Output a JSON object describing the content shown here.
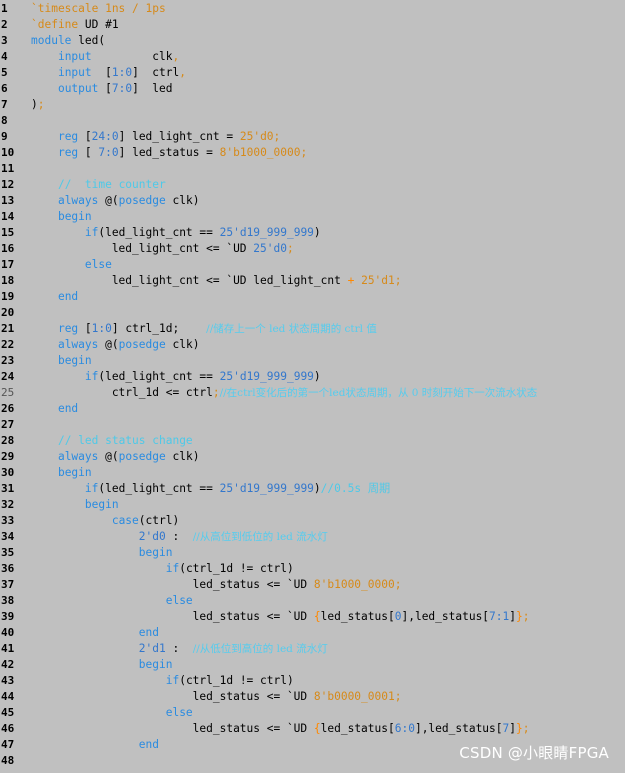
{
  "watermark": "CSDN @小眼睛FPGA",
  "lines": [
    {
      "n": "1",
      "parts": [
        [
          "dir",
          "`timescale 1ns / 1ps"
        ]
      ]
    },
    {
      "n": "2",
      "parts": [
        [
          "dir",
          "`define"
        ],
        [
          "",
          " UD #1"
        ]
      ]
    },
    {
      "n": "3",
      "parts": [
        [
          "kw",
          "module"
        ],
        [
          "",
          " led("
        ]
      ]
    },
    {
      "n": "4",
      "parts": [
        [
          "",
          "    "
        ],
        [
          "kw",
          "input"
        ],
        [
          "",
          "         clk"
        ],
        [
          "dir",
          ","
        ]
      ]
    },
    {
      "n": "5",
      "parts": [
        [
          "",
          "    "
        ],
        [
          "kw",
          "input"
        ],
        [
          "",
          "  ["
        ],
        [
          "num-b",
          "1:0"
        ],
        [
          "",
          "]  ctrl"
        ],
        [
          "dir",
          ","
        ]
      ]
    },
    {
      "n": "6",
      "parts": [
        [
          "",
          "    "
        ],
        [
          "kw",
          "output"
        ],
        [
          "",
          " ["
        ],
        [
          "num-b",
          "7:0"
        ],
        [
          "",
          "]  led"
        ]
      ]
    },
    {
      "n": "7",
      "parts": [
        [
          "",
          ")"
        ],
        [
          "dir",
          ";"
        ]
      ]
    },
    {
      "n": "8",
      "parts": []
    },
    {
      "n": "9",
      "parts": [
        [
          "",
          "    "
        ],
        [
          "kw",
          "reg"
        ],
        [
          "",
          " ["
        ],
        [
          "num-b",
          "24:0"
        ],
        [
          "",
          "] led_light_cnt = "
        ],
        [
          "num",
          "25'd0;"
        ]
      ]
    },
    {
      "n": "10",
      "parts": [
        [
          "",
          "    "
        ],
        [
          "kw",
          "reg"
        ],
        [
          "",
          " [ "
        ],
        [
          "num-b",
          "7:0"
        ],
        [
          "",
          "] led_status = "
        ],
        [
          "num",
          "8'b1000_0000;"
        ]
      ]
    },
    {
      "n": "11",
      "parts": []
    },
    {
      "n": "12",
      "parts": [
        [
          "",
          "    "
        ],
        [
          "cm",
          "//  time counter"
        ]
      ]
    },
    {
      "n": "13",
      "parts": [
        [
          "",
          "    "
        ],
        [
          "kw",
          "always"
        ],
        [
          "",
          " @("
        ],
        [
          "kw",
          "posedge"
        ],
        [
          "",
          " clk)"
        ]
      ]
    },
    {
      "n": "14",
      "parts": [
        [
          "",
          "    "
        ],
        [
          "kw",
          "begin"
        ]
      ]
    },
    {
      "n": "15",
      "parts": [
        [
          "",
          "        "
        ],
        [
          "kw",
          "if"
        ],
        [
          "",
          "(led_light_cnt == "
        ],
        [
          "num-b",
          "25'd19_999_999"
        ],
        [
          "",
          ")"
        ]
      ]
    },
    {
      "n": "16",
      "parts": [
        [
          "",
          "            led_light_cnt <= `UD "
        ],
        [
          "num-b",
          "25'd0"
        ],
        [
          "dir",
          ";"
        ]
      ]
    },
    {
      "n": "17",
      "parts": [
        [
          "",
          "        "
        ],
        [
          "kw",
          "else"
        ]
      ]
    },
    {
      "n": "18",
      "parts": [
        [
          "",
          "            led_light_cnt <= `UD led_light_cnt "
        ],
        [
          "op",
          "+"
        ],
        [
          "",
          " "
        ],
        [
          "num",
          "25'd1;"
        ]
      ]
    },
    {
      "n": "19",
      "parts": [
        [
          "",
          "    "
        ],
        [
          "kw",
          "end"
        ]
      ]
    },
    {
      "n": "20",
      "parts": []
    },
    {
      "n": "21",
      "parts": [
        [
          "",
          "    "
        ],
        [
          "kw",
          "reg"
        ],
        [
          "",
          " ["
        ],
        [
          "num-b",
          "1:0"
        ],
        [
          "",
          "] ctrl_1d;    "
        ],
        [
          "cm-cn",
          "//储存上一个 led 状态周期的 ctrl 值"
        ]
      ]
    },
    {
      "n": "22",
      "parts": [
        [
          "",
          "    "
        ],
        [
          "kw",
          "always"
        ],
        [
          "",
          " @("
        ],
        [
          "kw",
          "posedge"
        ],
        [
          "",
          " clk)"
        ]
      ]
    },
    {
      "n": "23",
      "parts": [
        [
          "",
          "    "
        ],
        [
          "kw",
          "begin"
        ]
      ]
    },
    {
      "n": "24",
      "parts": [
        [
          "",
          "        "
        ],
        [
          "kw",
          "if"
        ],
        [
          "",
          "(led_light_cnt == "
        ],
        [
          "num-b",
          "25'd19_999_999"
        ],
        [
          "",
          ")"
        ]
      ]
    },
    {
      "n": "25",
      "dim": true,
      "parts": [
        [
          "",
          "            ctrl_1d <= ctrl"
        ],
        [
          "dir",
          ";"
        ],
        [
          "cm-cn",
          "//在ctrl变化后的第一个led状态周期，从 0 时刻开始下一次流水状态"
        ]
      ]
    },
    {
      "n": "26",
      "parts": [
        [
          "",
          "    "
        ],
        [
          "kw",
          "end"
        ]
      ]
    },
    {
      "n": "27",
      "parts": []
    },
    {
      "n": "28",
      "parts": [
        [
          "",
          "    "
        ],
        [
          "cm",
          "// led status change"
        ]
      ]
    },
    {
      "n": "29",
      "parts": [
        [
          "",
          "    "
        ],
        [
          "kw",
          "always"
        ],
        [
          "",
          " @("
        ],
        [
          "kw",
          "posedge"
        ],
        [
          "",
          " clk)"
        ]
      ]
    },
    {
      "n": "30",
      "parts": [
        [
          "",
          "    "
        ],
        [
          "kw",
          "begin"
        ]
      ]
    },
    {
      "n": "31",
      "parts": [
        [
          "",
          "        "
        ],
        [
          "kw",
          "if"
        ],
        [
          "",
          "(led_light_cnt == "
        ],
        [
          "num-b",
          "25'd19_999_999"
        ],
        [
          "",
          ")"
        ],
        [
          "cm",
          "//0.5s 周期"
        ]
      ]
    },
    {
      "n": "32",
      "parts": [
        [
          "",
          "        "
        ],
        [
          "kw",
          "begin"
        ]
      ]
    },
    {
      "n": "33",
      "parts": [
        [
          "",
          "            "
        ],
        [
          "kw",
          "case"
        ],
        [
          "",
          "(ctrl)"
        ]
      ]
    },
    {
      "n": "34",
      "parts": [
        [
          "",
          "                "
        ],
        [
          "num-b",
          "2'd0"
        ],
        [
          "",
          " :  "
        ],
        [
          "cm-cn",
          "//从高位到低位的 led 流水灯"
        ]
      ]
    },
    {
      "n": "35",
      "parts": [
        [
          "",
          "                "
        ],
        [
          "kw",
          "begin"
        ]
      ]
    },
    {
      "n": "36",
      "parts": [
        [
          "",
          "                    "
        ],
        [
          "kw",
          "if"
        ],
        [
          "",
          "(ctrl_1d != ctrl)"
        ]
      ]
    },
    {
      "n": "37",
      "parts": [
        [
          "",
          "                        led_status <= `UD "
        ],
        [
          "num",
          "8'b1000_0000;"
        ]
      ]
    },
    {
      "n": "38",
      "parts": [
        [
          "",
          "                    "
        ],
        [
          "kw",
          "else"
        ]
      ]
    },
    {
      "n": "39",
      "parts": [
        [
          "",
          "                        led_status <= `UD "
        ],
        [
          "op",
          "{"
        ],
        [
          "",
          "led_status["
        ],
        [
          "num-b",
          "0"
        ],
        [
          "",
          "],led_status["
        ],
        [
          "num-b",
          "7:1"
        ],
        [
          "",
          "]"
        ],
        [
          "op",
          "}"
        ],
        [
          "dir",
          ";"
        ]
      ]
    },
    {
      "n": "40",
      "parts": [
        [
          "",
          "                "
        ],
        [
          "kw",
          "end"
        ]
      ]
    },
    {
      "n": "41",
      "parts": [
        [
          "",
          "                "
        ],
        [
          "num-b",
          "2'd1"
        ],
        [
          "",
          " :  "
        ],
        [
          "cm-cn",
          "//从低位到高位的 led 流水灯"
        ]
      ]
    },
    {
      "n": "42",
      "parts": [
        [
          "",
          "                "
        ],
        [
          "kw",
          "begin"
        ]
      ]
    },
    {
      "n": "43",
      "parts": [
        [
          "",
          "                    "
        ],
        [
          "kw",
          "if"
        ],
        [
          "",
          "(ctrl_1d != ctrl)"
        ]
      ]
    },
    {
      "n": "44",
      "parts": [
        [
          "",
          "                        led_status <= `UD "
        ],
        [
          "num",
          "8'b0000_0001;"
        ]
      ]
    },
    {
      "n": "45",
      "parts": [
        [
          "",
          "                    "
        ],
        [
          "kw",
          "else"
        ]
      ]
    },
    {
      "n": "46",
      "parts": [
        [
          "",
          "                        led_status <= `UD "
        ],
        [
          "op",
          "{"
        ],
        [
          "",
          "led_status["
        ],
        [
          "num-b",
          "6:0"
        ],
        [
          "",
          "],led_status["
        ],
        [
          "num-b",
          "7"
        ],
        [
          "",
          "]"
        ],
        [
          "op",
          "}"
        ],
        [
          "dir",
          ";"
        ]
      ]
    },
    {
      "n": "47",
      "parts": [
        [
          "",
          "                "
        ],
        [
          "kw",
          "end"
        ]
      ]
    },
    {
      "n": "48",
      "parts": []
    }
  ]
}
